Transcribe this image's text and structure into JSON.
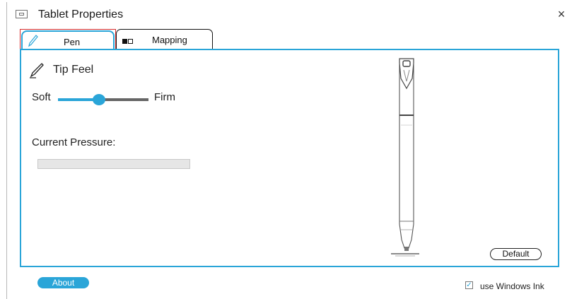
{
  "window": {
    "title": "Tablet Properties",
    "close_glyph": "×"
  },
  "tabs": [
    {
      "label": "Pen",
      "icon": "pen-icon",
      "selected": true
    },
    {
      "label": "Mapping",
      "icon": "mapping-icon",
      "selected": false
    }
  ],
  "pen_panel": {
    "tip_feel_label": "Tip Feel",
    "soft_label": "Soft",
    "firm_label": "Firm",
    "tip_feel_value": 0.45,
    "current_pressure_label": "Current Pressure:",
    "current_pressure_value": 0,
    "default_button": "Default"
  },
  "footer": {
    "about_button": "About",
    "windows_ink_label": "use Windows Ink",
    "windows_ink_checked": true,
    "check_glyph": "✓"
  },
  "colors": {
    "accent": "#2aa5d8",
    "highlight_border": "#d62a2a"
  }
}
